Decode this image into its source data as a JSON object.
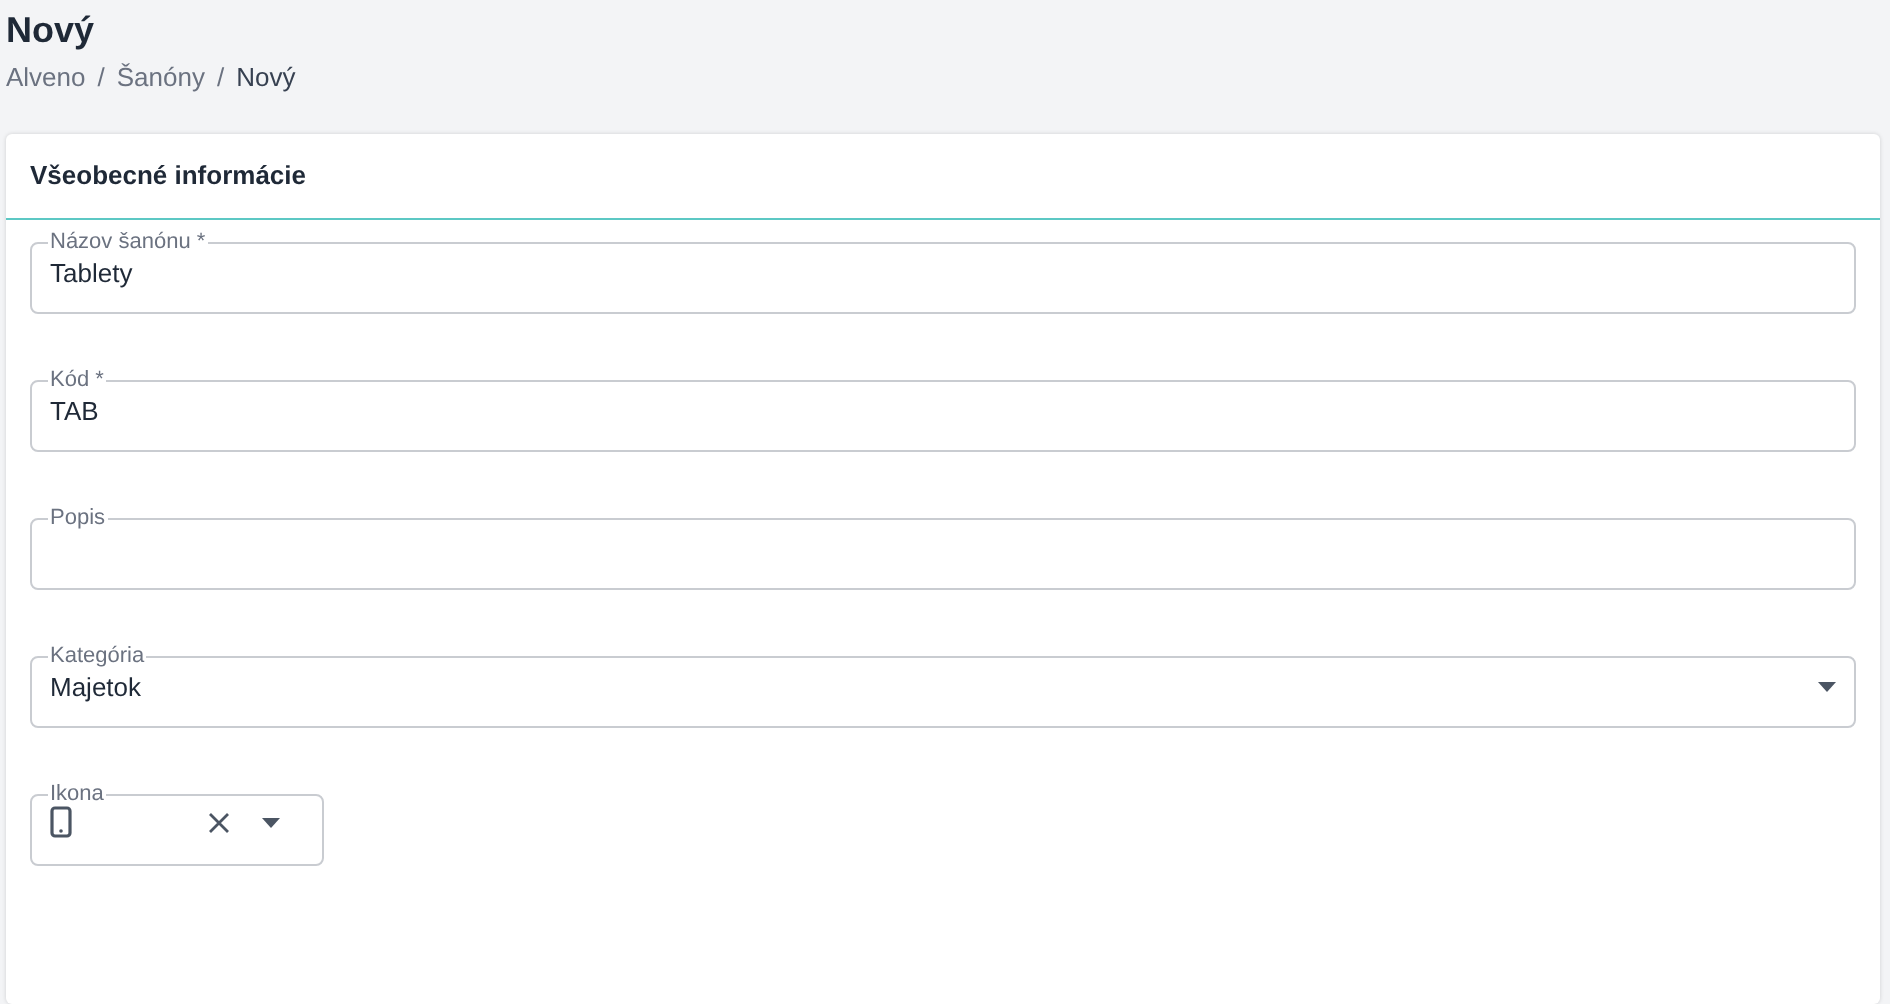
{
  "page": {
    "title": "Nový",
    "breadcrumb": [
      {
        "kind": "link",
        "text": "Alveno"
      },
      {
        "kind": "separator",
        "text": "/"
      },
      {
        "kind": "link",
        "text": "Šanóny"
      },
      {
        "kind": "separator",
        "text": "/"
      },
      {
        "kind": "current",
        "text": "Nový"
      }
    ]
  },
  "card": {
    "title": "Všeobecné informácie",
    "fields": [
      {
        "kind": "text",
        "label": "Názov šanónu *",
        "value": "Tablety"
      },
      {
        "kind": "text",
        "label": "Kód *",
        "value": "TAB"
      },
      {
        "kind": "text",
        "label": "Popis"
      },
      {
        "kind": "select",
        "label": "Kategória",
        "value": "Majetok"
      },
      {
        "kind": "icon-select",
        "label": "Ikona"
      }
    ]
  }
}
